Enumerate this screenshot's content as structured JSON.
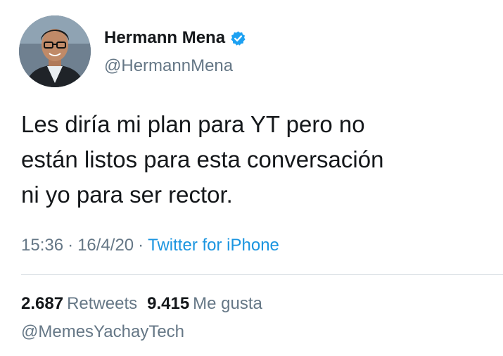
{
  "author": {
    "display_name": "Hermann Mena",
    "handle": "@HermannMena",
    "verified": true,
    "avatar_icon": "profile-photo"
  },
  "tweet": {
    "lines": [
      "Les diría mi plan para YT pero no",
      "están listos para esta conversación",
      "ni yo para ser rector."
    ],
    "time": "15:36",
    "date": "16/4/20",
    "separator": "·",
    "source": "Twitter for iPhone"
  },
  "stats": {
    "retweets_count": "2.687",
    "retweets_label": "Retweets",
    "likes_count": "9.415",
    "likes_label": "Me gusta"
  },
  "watermark": "@MemesYachayTech",
  "colors": {
    "text": "#14171a",
    "secondary": "#657786",
    "link": "#1b95e0",
    "verified": "#1da1f2"
  }
}
